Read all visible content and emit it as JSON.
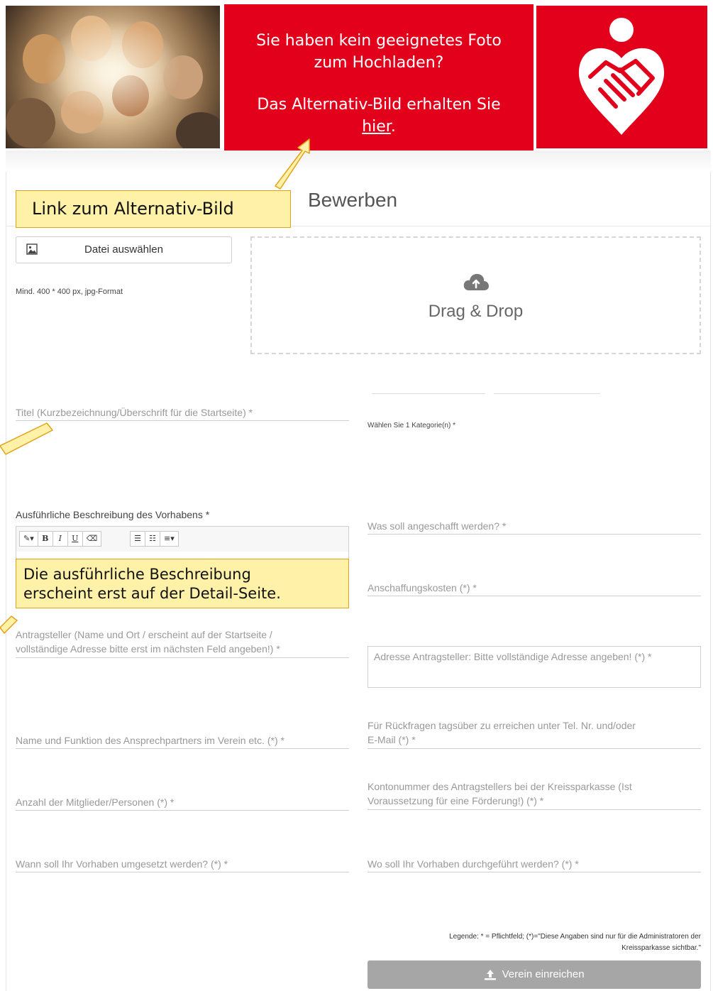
{
  "banner": {
    "question_line1": "Sie haben kein geeignetes Foto",
    "question_line2": "zum Hochladen?",
    "alt_line": "Das Alternativ-Bild erhalten Sie",
    "alt_link": "hier",
    "alt_period": "."
  },
  "page_title": "Bewerben",
  "upload": {
    "button_label": "Datei auswählen",
    "hint": "Mind. 400 * 400 px, jpg-Format",
    "dropzone_label": "Drag & Drop"
  },
  "fields": {
    "title_placeholder": "Titel (Kurzbezeichnung/Überschrift für die Startseite) *",
    "category_label": "Wählen Sie 1 Kategorie(n) *",
    "description_label": "Ausführliche Beschreibung des Vorhabens *",
    "purchase_placeholder": "Was soll angeschafft werden? *",
    "cost_placeholder": "Anschaffungskosten (*) *",
    "applicant_line1": "Antragsteller (Name und Ort / erscheint auf der Startseite /",
    "applicant_line2": "vollständige Adresse bitte erst im nächsten Feld angeben!) *",
    "address_placeholder": "Adresse Antragsteller: Bitte vollständige Adresse angeben! (*) *",
    "contact_person_placeholder": "Name und Funktion des Ansprechpartners im Verein etc. (*) *",
    "phone_line1": "Für Rückfragen tagsüber zu erreichen unter Tel. Nr. und/oder",
    "phone_line2": "E-Mail (*) *",
    "members_placeholder": "Anzahl der Mitglieder/Personen (*) *",
    "account_line1": "Kontonummer des Antragstellers bei der Kreissparkasse (Ist",
    "account_line2": "Voraussetzung für eine Förderung!) (*) *",
    "when_placeholder": "Wann soll Ihr Vorhaben umgesetzt werden? (*) *",
    "where_placeholder": "Wo soll Ihr Vorhaben durchgeführt werden? (*) *"
  },
  "legend_line1": "Legende: * = Pflichtfeld; (*)=\"Diese Angaben sind nur für die Administratoren der",
  "legend_line2": "Kreissparkasse sichtbar.\"",
  "submit_label": "Verein einreichen",
  "callouts": {
    "alt_image": "Link zum Alternativ-Bild",
    "description_line1": "Die ausführliche Beschreibung",
    "description_line2": "erscheint erst auf der Detail-Seite."
  },
  "colors": {
    "brand_red": "#e2001a",
    "callout_fill": "#fff2a8",
    "callout_border": "#e0a21a",
    "submit_gray": "#a6a6a6"
  }
}
